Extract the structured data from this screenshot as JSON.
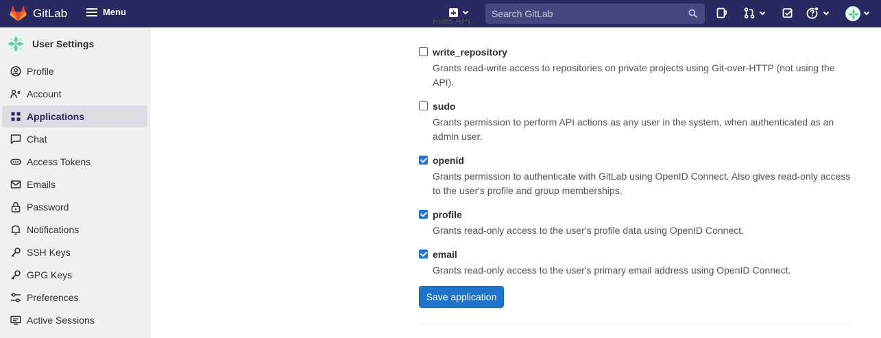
{
  "topbar": {
    "brand": "GitLab",
    "menu_label": "Menu",
    "search_placeholder": "Search GitLab"
  },
  "sidebar": {
    "title": "User Settings",
    "items": [
      {
        "label": "Profile",
        "icon": "profile-icon"
      },
      {
        "label": "Account",
        "icon": "account-icon"
      },
      {
        "label": "Applications",
        "icon": "applications-icon",
        "active": true
      },
      {
        "label": "Chat",
        "icon": "chat-icon"
      },
      {
        "label": "Access Tokens",
        "icon": "token-icon"
      },
      {
        "label": "Emails",
        "icon": "mail-icon"
      },
      {
        "label": "Password",
        "icon": "lock-icon"
      },
      {
        "label": "Notifications",
        "icon": "bell-icon"
      },
      {
        "label": "SSH Keys",
        "icon": "key-icon"
      },
      {
        "label": "GPG Keys",
        "icon": "key-icon"
      },
      {
        "label": "Preferences",
        "icon": "preferences-icon"
      },
      {
        "label": "Active Sessions",
        "icon": "monitor-icon"
      }
    ]
  },
  "main": {
    "cut_text": "Files API.",
    "scopes": [
      {
        "name": "write_repository",
        "checked": false,
        "description": "Grants read-write access to repositories on private projects using Git-over-HTTP (not using the API)."
      },
      {
        "name": "sudo",
        "checked": false,
        "description": "Grants permission to perform API actions as any user in the system, when authenticated as an admin user."
      },
      {
        "name": "openid",
        "checked": true,
        "description": "Grants permission to authenticate with GitLab using OpenID Connect. Also gives read-only access to the user's profile and group memberships."
      },
      {
        "name": "profile",
        "checked": true,
        "description": "Grants read-only access to the user's profile data using OpenID Connect."
      },
      {
        "name": "email",
        "checked": true,
        "description": "Grants read-only access to the user's primary email address using OpenID Connect."
      }
    ],
    "save_label": "Save application"
  },
  "colors": {
    "topbar": "#292961",
    "accent": "#1f75cb",
    "sidebar_bg": "#f0f0f0"
  }
}
